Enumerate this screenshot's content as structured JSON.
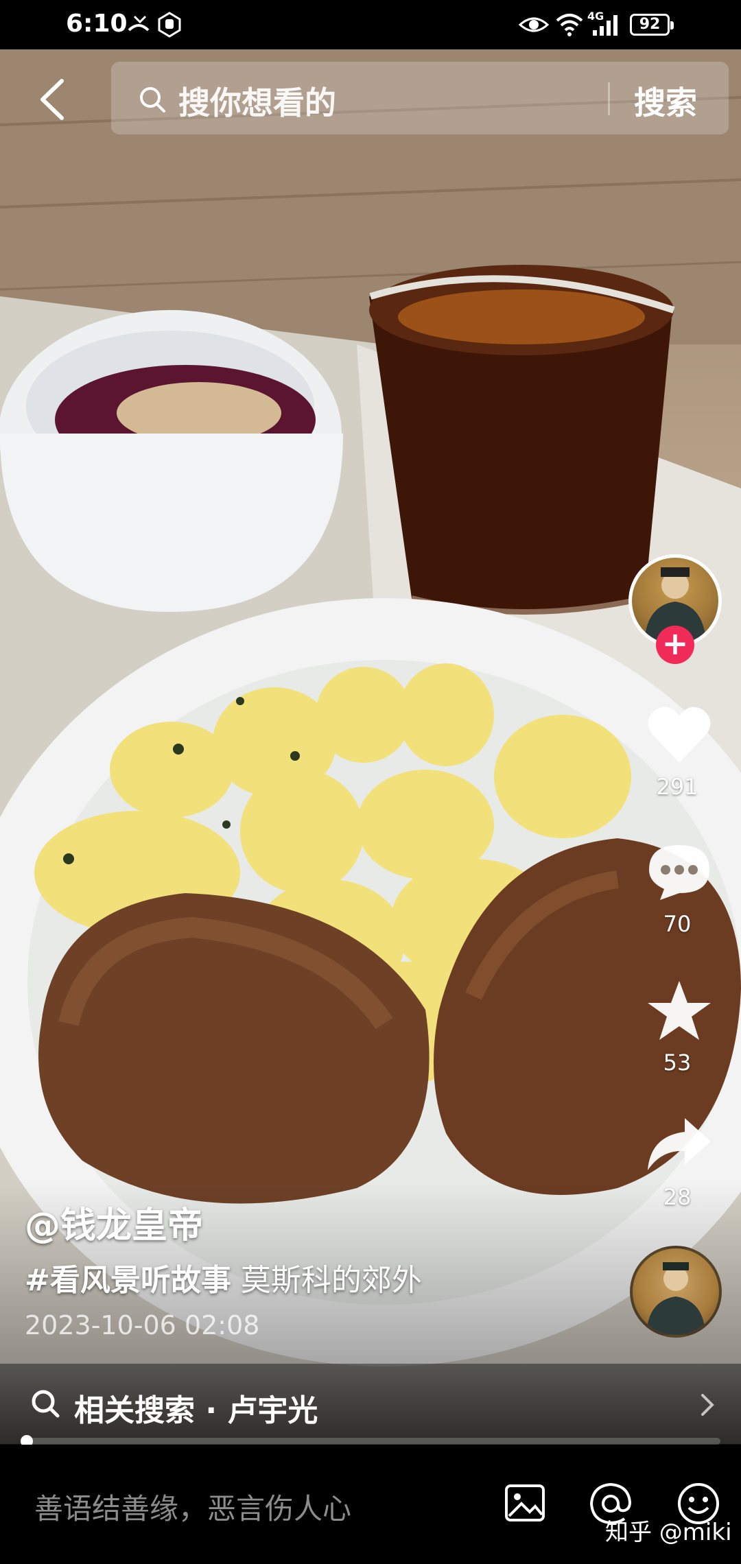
{
  "status_bar": {
    "time": "6:10",
    "battery": "92",
    "network": "4G"
  },
  "search": {
    "placeholder": "搜你想看的",
    "button_label": "搜索"
  },
  "right_rail": {
    "likes": "291",
    "comments": "70",
    "favorites": "53",
    "shares": "28"
  },
  "caption": {
    "author": "@钱龙皇帝",
    "hashtag": "#看风景听故事",
    "title": "莫斯科的郊外",
    "date": "2023-10-06 02:08"
  },
  "related_search": {
    "label": "相关搜索 · 卢宇光"
  },
  "progress": {
    "played_fraction": 0.01
  },
  "comment_bar": {
    "placeholder": "善语结善缘，恶言伤人心"
  },
  "watermark": "知乎 @miki",
  "icons": [
    "back-icon",
    "search-icon",
    "heart-icon",
    "comment-icon",
    "star-icon",
    "share-icon",
    "image-icon",
    "at-icon",
    "emoji-icon",
    "chevron-right-icon"
  ]
}
